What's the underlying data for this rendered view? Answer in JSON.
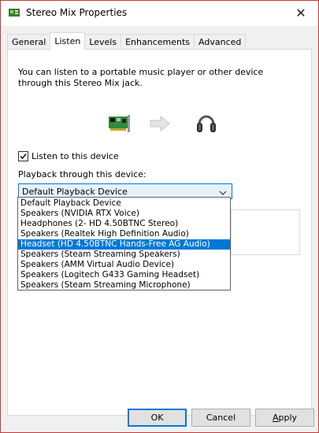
{
  "window": {
    "title": "Stereo Mix Properties",
    "close_glyph": "✕"
  },
  "tabs": [
    {
      "label": "General",
      "active": false
    },
    {
      "label": "Listen",
      "active": true
    },
    {
      "label": "Levels",
      "active": false
    },
    {
      "label": "Enhancements",
      "active": false
    },
    {
      "label": "Advanced",
      "active": false
    }
  ],
  "listen": {
    "description": "You can listen to a portable music player or other device through this Stereo Mix jack.",
    "listen_checkbox_label": "Listen to this device",
    "listen_checked": true,
    "playback_label": "Playback through this device:",
    "playback_selected": "Default Playback Device"
  },
  "dropdown": {
    "options": [
      "Default Playback Device",
      "Speakers (NVIDIA RTX Voice)",
      "Headphones (2- HD 4.50BTNC Stereo)",
      "Speakers (Realtek High Definition Audio)",
      "Headset (HD 4.50BTNC Hands-Free AG Audio)",
      "Speakers (Steam Streaming Speakers)",
      "Speakers (AMM Virtual Audio Device)",
      "Speakers (Logitech G433 Gaming Headset)",
      "Speakers (Steam Streaming Microphone)"
    ],
    "highlighted_index": 4
  },
  "buttons": {
    "ok": "OK",
    "cancel": "Cancel",
    "apply_first": "A",
    "apply_rest": "pply"
  },
  "colors": {
    "accent": "#0078d7",
    "border_red": "#c33b3b"
  },
  "icons": [
    "sound-card-icon",
    "arrow-right-icon",
    "headphones-icon",
    "speaker-window-icon"
  ]
}
